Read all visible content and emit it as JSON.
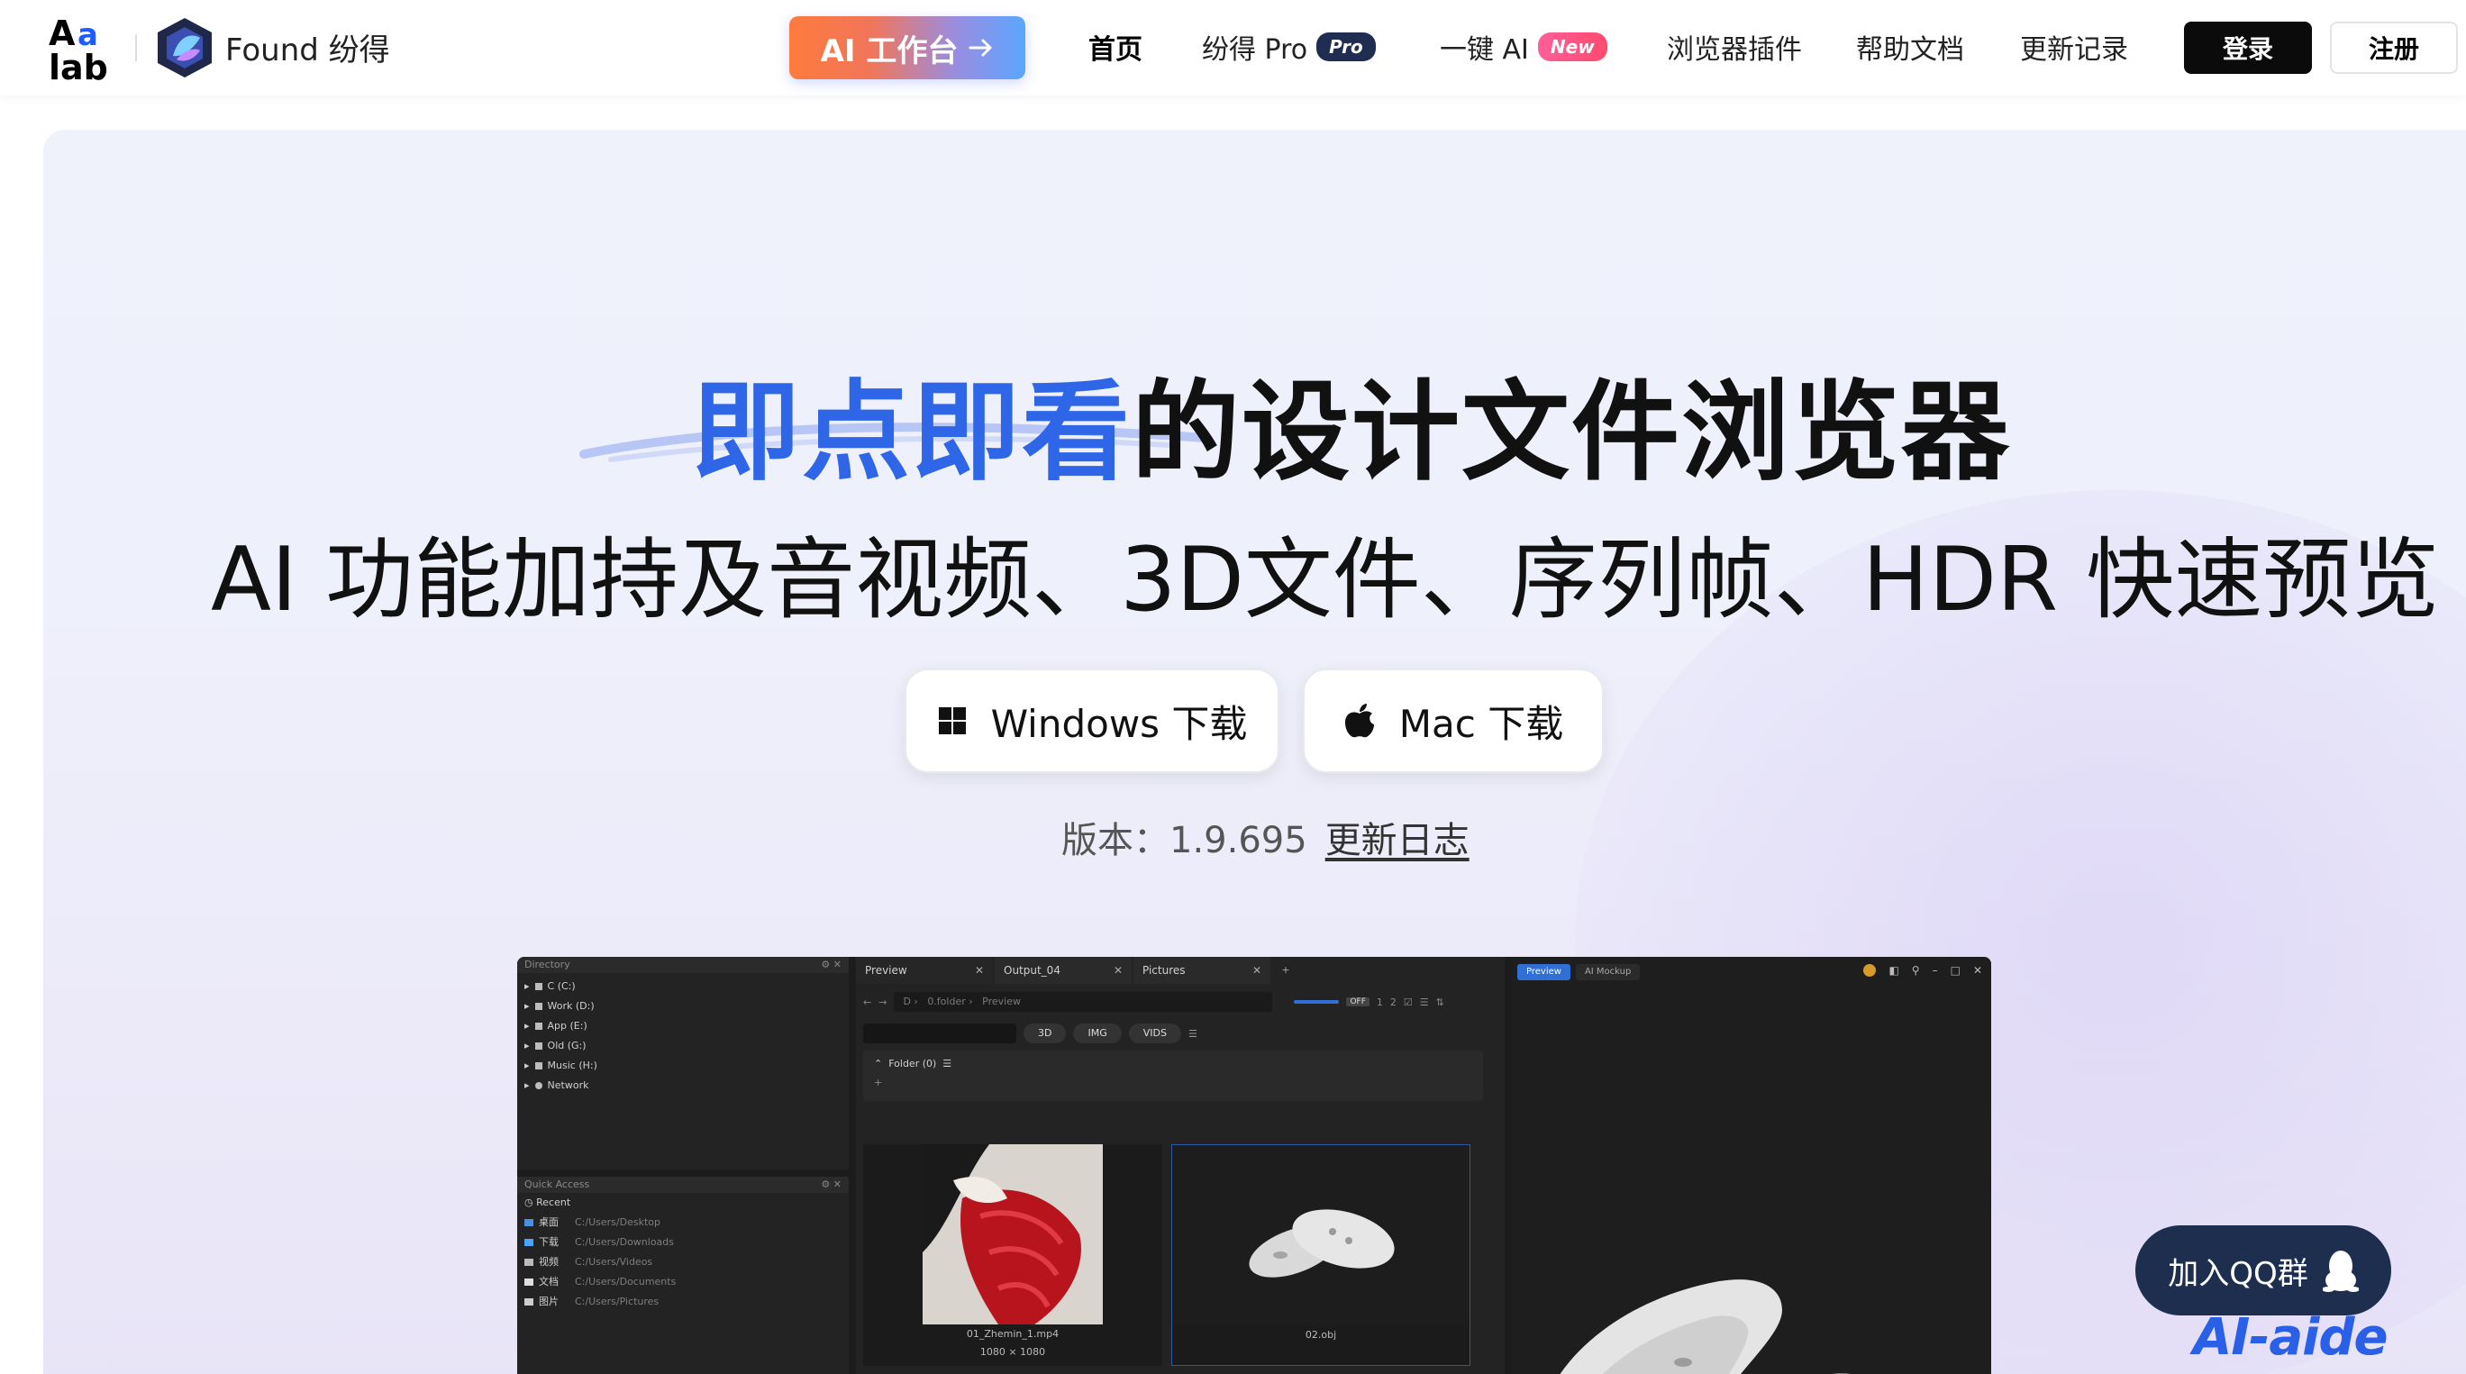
{
  "header": {
    "brand_name": "Found 纷得",
    "ai_button": "AI 工作台",
    "nav": [
      {
        "label": "首页",
        "badge": ""
      },
      {
        "label": "纷得 Pro",
        "badge": "Pro"
      },
      {
        "label": "一键 AI",
        "badge": "New"
      },
      {
        "label": "浏览器插件",
        "badge": ""
      },
      {
        "label": "帮助文档",
        "badge": ""
      },
      {
        "label": "更新记录",
        "badge": ""
      }
    ],
    "login": "登录",
    "register": "注册"
  },
  "hero": {
    "title_accent": "即点即看",
    "title_rest": "的设计文件浏览器",
    "subtitle": "AI 功能加持及音视频、3D文件、序列帧、HDR 快速预览",
    "windows_download": "Windows 下载",
    "mac_download": "Mac 下载",
    "version_label": "版本：1.9.695",
    "changelog_link": "更新日志"
  },
  "app": {
    "directory": {
      "title": "Directory",
      "items": [
        "C (C:)",
        "Work (D:)",
        "App (E:)",
        "Old (G:)",
        "Music (H:)",
        "Network"
      ]
    },
    "quick_access": {
      "title": "Quick Access",
      "recent": "Recent",
      "items": [
        {
          "name": "桌面",
          "path": "C:/Users/Desktop"
        },
        {
          "name": "下载",
          "path": "C:/Users/Downloads"
        },
        {
          "name": "视频",
          "path": "C:/Users/Videos"
        },
        {
          "name": "文档",
          "path": "C:/Users/Documents"
        },
        {
          "name": "图片",
          "path": "C:/Users/Pictures"
        }
      ]
    },
    "tabs": [
      "Preview",
      "Output_04",
      "Pictures"
    ],
    "address": {
      "drive": "D",
      "folder": "0.folder",
      "sub": "Preview"
    },
    "filters": [
      "3D",
      "IMG",
      "VIDS"
    ],
    "folder_row": "Folder (0)",
    "thumbs": [
      {
        "name": "01_Zhemin_1.mp4",
        "size": "1080 × 1080"
      },
      {
        "name": "02.obj",
        "size": ""
      }
    ],
    "right_tabs": [
      "Preview",
      "AI Mockup"
    ],
    "toggle_off": "OFF",
    "toggle_vals": [
      "1",
      "2"
    ]
  },
  "floating": {
    "qq": "加入QQ群",
    "watermark": "AI-aide"
  }
}
